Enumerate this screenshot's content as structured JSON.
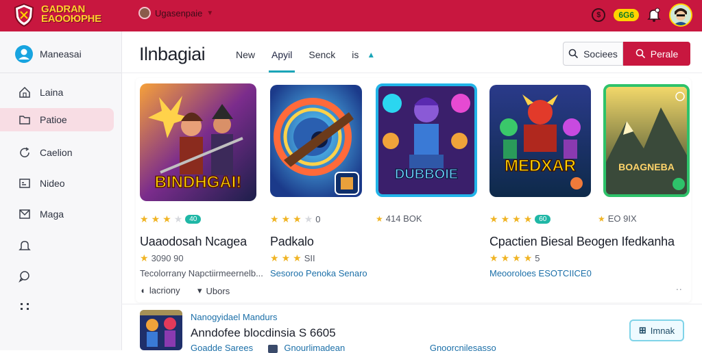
{
  "app": {
    "logo_text_line1": "GADRAN",
    "logo_text_line2": "ЕАООЮРНЕ",
    "user_name": "Ugasenpaie",
    "points": "6G6"
  },
  "sidebar": {
    "user_label": "Maneasai",
    "items": [
      {
        "label": "Laina",
        "icon": "home-icon"
      },
      {
        "label": "Patioe",
        "icon": "folder-icon",
        "active": true
      },
      {
        "label": "Caelion",
        "icon": "refresh-icon"
      },
      {
        "label": "Nideo",
        "icon": "video-icon"
      },
      {
        "label": "Maga",
        "icon": "mail-icon"
      },
      {
        "label": "",
        "icon": "bell-icon"
      },
      {
        "label": "",
        "icon": "chat-icon"
      },
      {
        "label": "",
        "icon": "more-icon"
      }
    ]
  },
  "header": {
    "title": "Ilnbagiai",
    "tabs": [
      {
        "label": "New"
      },
      {
        "label": "Apyil",
        "active": true
      },
      {
        "label": "Senck"
      },
      {
        "label": "is"
      }
    ],
    "search_label": "Sociees",
    "primary_label": "Perale"
  },
  "cards": [
    {
      "rating": 3.5,
      "badge": "40",
      "title": "Uaaodosah Ncagea",
      "sub": "3090 90",
      "extra": "Tecolorrany Napctiirmeernelb...",
      "action1": "lacriony",
      "action2": "Ubors",
      "art_text": "BINDHGAI!"
    },
    {
      "rating": 3.5,
      "count": "0",
      "title": "Padkalo",
      "sub": "SII",
      "link": "Sesoroo Penoka Senaro",
      "art_text": ""
    },
    {
      "rating": 0,
      "count": "414 BOK",
      "title": "",
      "art_text": "DUBBOIE"
    },
    {
      "rating": 4,
      "badge": "60",
      "title": "Cpactien Biesal Beogen Ifedkanha",
      "sub": "5",
      "link": "Meooroloes ESOTCIICE0",
      "art_text": "MEDXAR"
    },
    {
      "rating": 0,
      "count": "EO 9IX",
      "title": "",
      "art_text": "BOAGNEBA"
    }
  ],
  "featured": {
    "category": "Nanogyidael Mandurs",
    "title": "Anndofee blocdinsia S 6605",
    "meta1": "Goadde Sarees",
    "meta2": "Gnourlimadean",
    "meta3": "Gnoorcnilesasso",
    "button_label": "Imnak"
  },
  "colors": {
    "brand": "#c8173f",
    "accent": "#1aa5b8",
    "star": "#f0b424"
  }
}
